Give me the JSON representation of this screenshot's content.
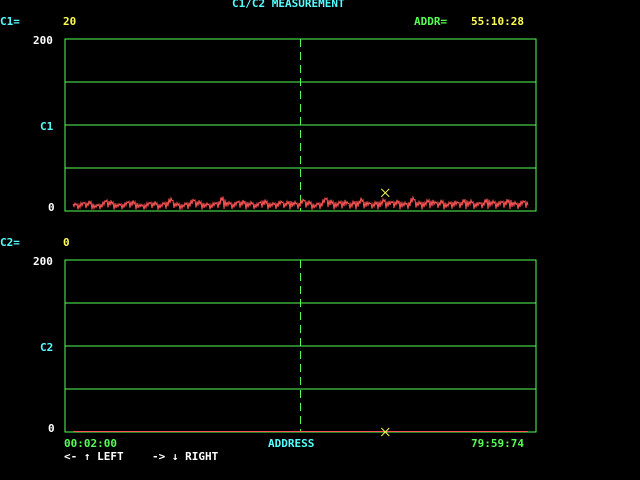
{
  "header": {
    "title": "C1/C2 MEASUREMENT",
    "addr_label": "ADDR=",
    "addr_value": "55:10:28"
  },
  "channel1": {
    "label": "C1=",
    "value": "20",
    "axis_name": "C1",
    "y_max_label": "200",
    "y_min_label": "0"
  },
  "channel2": {
    "label": "C2=",
    "value": "0",
    "axis_name": "C2",
    "y_max_label": "200",
    "y_min_label": "0"
  },
  "footer": {
    "start_address": "00:02:00",
    "axis_label": "ADDRESS",
    "end_address": "79:59:74",
    "nav_left": "<- ↑ LEFT",
    "nav_right": "-> ↓ RIGHT"
  },
  "colors": {
    "grid": "#55ff55",
    "trace": "#ff5555",
    "marker": "#ffff55",
    "axis_text": "#55ffff",
    "value_text": "#ffff55"
  },
  "chart_data": [
    {
      "type": "line",
      "series": [
        {
          "values": [
            8,
            7,
            9,
            10,
            6,
            8,
            12,
            9,
            7,
            8,
            11,
            9,
            6,
            8,
            10,
            7,
            9,
            13,
            8,
            7,
            9,
            12,
            10,
            8,
            7,
            9,
            15,
            9,
            8,
            11,
            10,
            9,
            7,
            12,
            9,
            8,
            10,
            9,
            11,
            8,
            12,
            10,
            7,
            9,
            14,
            10,
            9,
            11,
            8,
            10,
            13,
            9,
            8,
            10,
            12,
            9,
            11,
            10,
            8,
            14,
            9,
            10,
            12,
            9,
            11,
            8,
            10,
            9,
            12,
            11,
            8,
            9,
            13,
            10,
            9,
            11,
            12,
            8,
            10,
            11
          ]
        }
      ],
      "ylim": [
        0,
        200
      ],
      "cursor_value": 20,
      "cursor_position_fraction": 0.68
    },
    {
      "type": "line",
      "series": [
        {
          "values": [
            0,
            0,
            0,
            0,
            0,
            0,
            0,
            0,
            0,
            0
          ]
        }
      ],
      "ylim": [
        0,
        200
      ],
      "cursor_value": 0,
      "cursor_position_fraction": 0.68
    }
  ]
}
